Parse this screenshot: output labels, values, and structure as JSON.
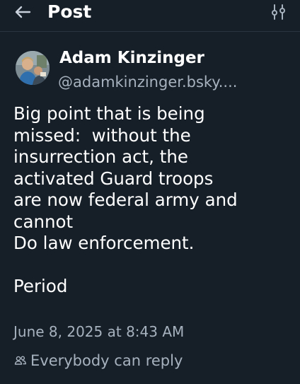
{
  "header": {
    "title": "Post",
    "back_icon": "arrow-left-icon",
    "filter_icon": "sliders-icon"
  },
  "author": {
    "display_name": "Adam Kinzinger",
    "handle": "@adamkinzinger.bsky....",
    "avatar": "profile-photo"
  },
  "post": {
    "text": "Big point that is being\nmissed:  without the\ninsurrection act, the\nactivated Guard troops\nare now federal army and\ncannot\nDo law enforcement.\n\nPeriod",
    "timestamp": "June 8, 2025 at 8:43 AM",
    "reply_setting": "Everybody can reply",
    "reply_icon": "people-icon"
  },
  "colors": {
    "background": "#161e27",
    "text_primary": "#ffffff",
    "text_secondary": "#a7b2bf",
    "divider": "#2a3440"
  }
}
